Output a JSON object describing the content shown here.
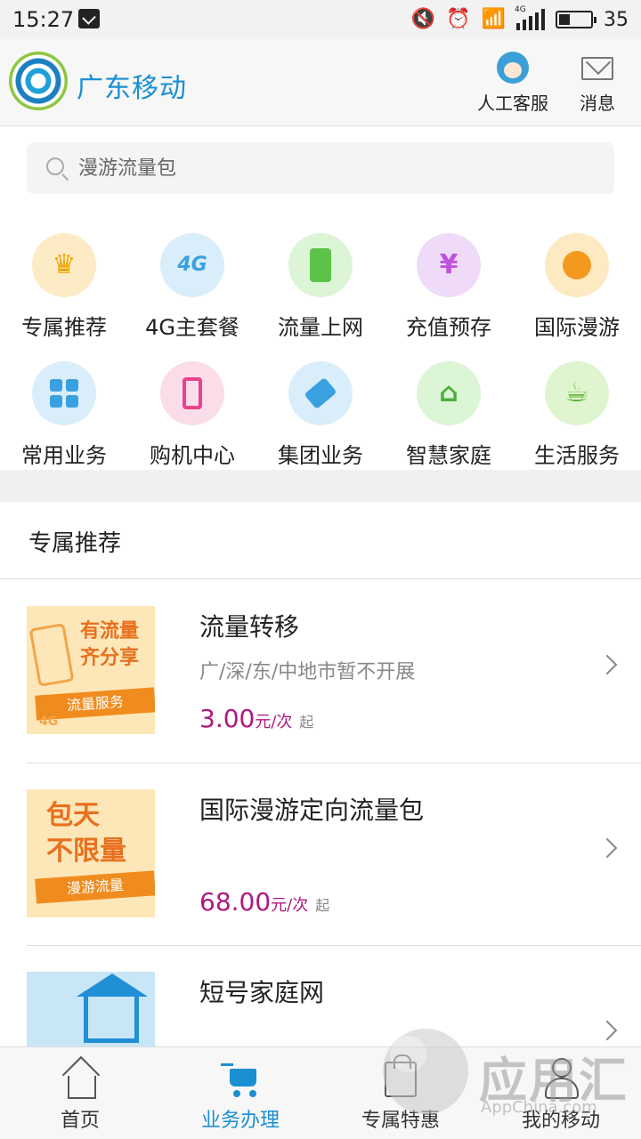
{
  "status_bar": {
    "time": "15:27",
    "battery": "35",
    "network": "4G",
    "icons": [
      "sim-icon",
      "mute-icon",
      "alarm-icon",
      "wifi-icon",
      "signal-icon",
      "battery-icon"
    ]
  },
  "header": {
    "brand": "广东移动",
    "customer_service": "人工客服",
    "messages": "消息"
  },
  "search": {
    "placeholder": "漫游流量包"
  },
  "categories": [
    {
      "label": "专属推荐",
      "icon": "crown-icon",
      "color": "#fdebc6"
    },
    {
      "label": "4G主套餐",
      "icon": "4g-icon",
      "color": "#d9eefa"
    },
    {
      "label": "流量上网",
      "icon": "phone-data-icon",
      "color": "#dbf5d6"
    },
    {
      "label": "充值预存",
      "icon": "yen-icon",
      "color": "#efdbf7"
    },
    {
      "label": "国际漫游",
      "icon": "globe-icon",
      "color": "#fde9c2"
    },
    {
      "label": "常用业务",
      "icon": "grid-icon",
      "color": "#d9eefa"
    },
    {
      "label": "购机中心",
      "icon": "mobile-icon",
      "color": "#fbdde9"
    },
    {
      "label": "集团业务",
      "icon": "tag-icon",
      "color": "#d9eefa"
    },
    {
      "label": "智慧家庭",
      "icon": "smart-home-icon",
      "color": "#dbf5d6"
    },
    {
      "label": "生活服务",
      "icon": "coffee-icon",
      "color": "#def5d0"
    }
  ],
  "section": {
    "title": "专属推荐"
  },
  "items": [
    {
      "title": "流量转移",
      "subtitle": "广/深/东/中地市暂不开展",
      "price": "3.00",
      "unit": "元/次",
      "suffix": "起",
      "thumb_text": "有流量\n齐分享",
      "thumb_ribbon": "流量服务",
      "thumb_badge": "4G"
    },
    {
      "title": "国际漫游定向流量包",
      "subtitle": "",
      "price": "68.00",
      "unit": "元/次",
      "suffix": "起",
      "thumb_text": "包天\n不限量",
      "thumb_ribbon": "漫游流量"
    },
    {
      "title": "短号家庭网",
      "subtitle": "",
      "price": "",
      "unit": "",
      "suffix": ""
    }
  ],
  "tabs": [
    {
      "label": "首页",
      "icon": "home-icon",
      "active": false
    },
    {
      "label": "业务办理",
      "icon": "cart-icon",
      "active": true
    },
    {
      "label": "专属特惠",
      "icon": "bag-icon",
      "active": false
    },
    {
      "label": "我的移动",
      "icon": "user-icon",
      "active": false
    }
  ],
  "watermark": {
    "text": "应用汇",
    "sub": "AppChina.com"
  },
  "colors": {
    "brand": "#1a8fd2",
    "price": "#b0187e",
    "active_tab": "#1a8fd2"
  }
}
